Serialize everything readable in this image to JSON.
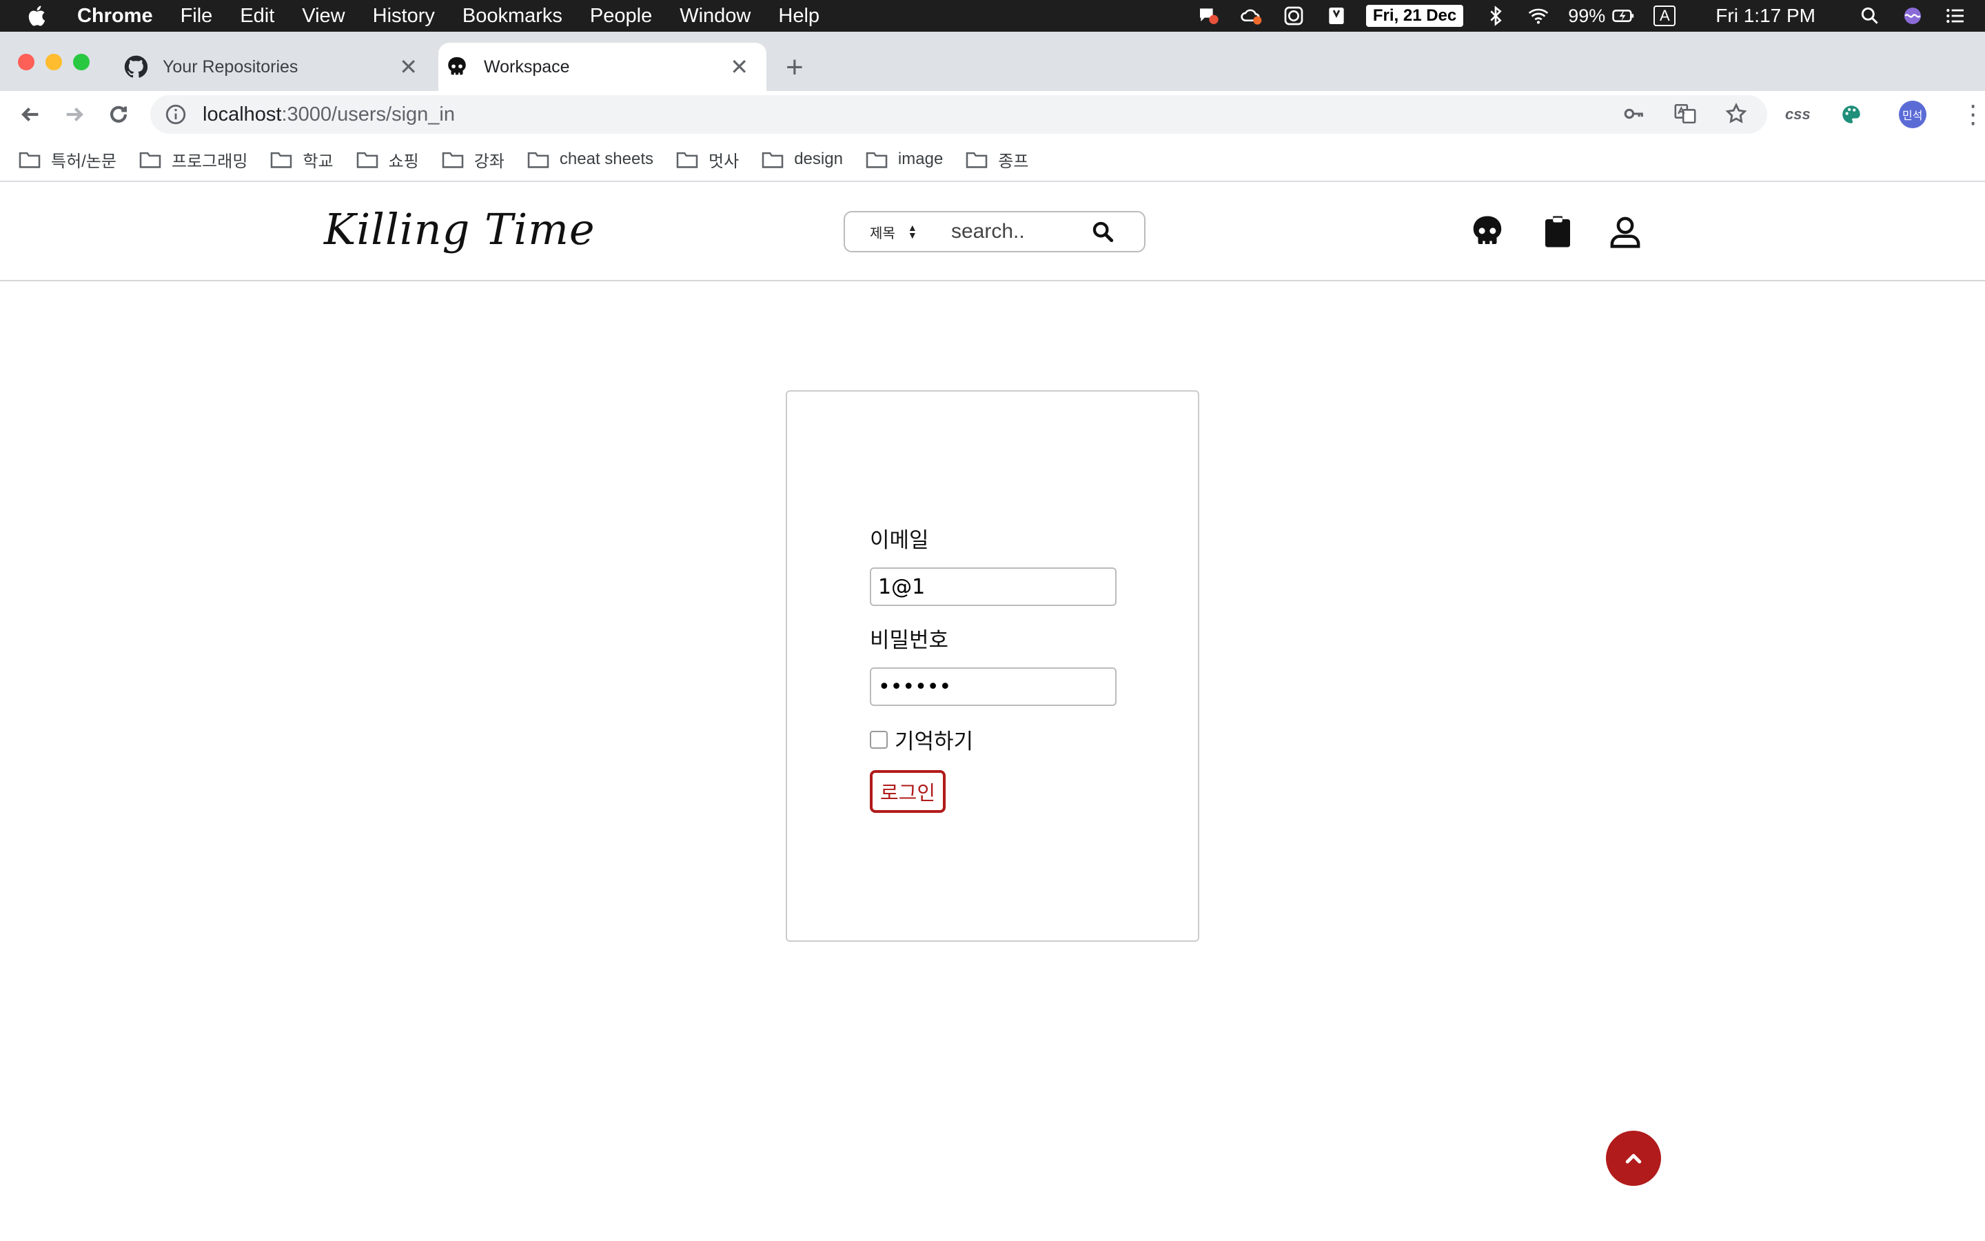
{
  "menubar": {
    "app": "Chrome",
    "items": [
      "File",
      "Edit",
      "View",
      "History",
      "Bookmarks",
      "People",
      "Window",
      "Help"
    ],
    "date": "Fri, 21 Dec",
    "battery": "99%",
    "input_source": "A",
    "time": "Fri 1:17 PM"
  },
  "tabs": [
    {
      "title": "Your Repositories",
      "icon": "github-icon",
      "active": false
    },
    {
      "title": "Workspace",
      "icon": "skull-icon",
      "active": true
    }
  ],
  "omnibox": {
    "host": "localhost",
    "path": ":3000/users/sign_in"
  },
  "extensions": {
    "css_label": "css",
    "profile_initials": "민석"
  },
  "bookmarks": [
    "특허/논문",
    "프로그래밍",
    "학교",
    "쇼핑",
    "강좌",
    "cheat sheets",
    "멋사",
    "design",
    "image",
    "종프"
  ],
  "site": {
    "logo": "Killing Time",
    "search_select": "제목",
    "search_placeholder": "search.."
  },
  "login": {
    "email_label": "이메일",
    "email_value": "1@1",
    "password_label": "비밀번호",
    "password_value": "••••••",
    "remember_label": "기억하기",
    "remember_checked": false,
    "submit_label": "로그인"
  },
  "colors": {
    "accent": "#b11b1b",
    "menubar": "#1e1e1e",
    "tabstrip": "#dee1e6"
  }
}
